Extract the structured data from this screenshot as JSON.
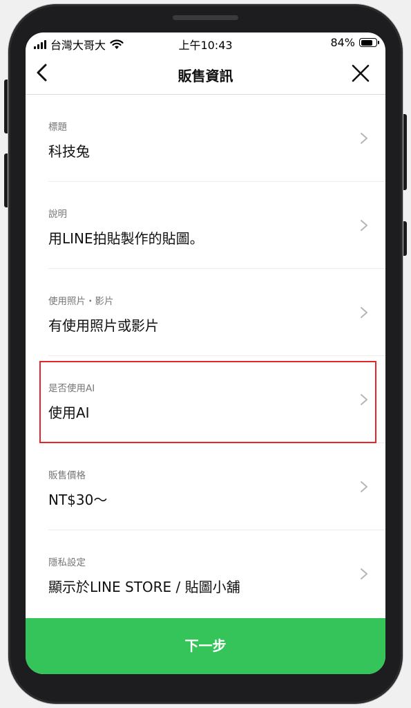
{
  "status_bar": {
    "carrier": "台灣大哥大",
    "time": "上午10:43",
    "battery": "84%",
    "battery_level": 0.84
  },
  "nav": {
    "title": "販售資訊",
    "back_icon": "chevron-left-icon",
    "close_icon": "close-icon"
  },
  "items": [
    {
      "label": "標題",
      "value": "科技兔"
    },
    {
      "label": "說明",
      "value": "用LINE拍貼製作的貼圖。"
    },
    {
      "label": "使用照片・影片",
      "value": "有使用照片或影片"
    },
    {
      "label": "是否使用AI",
      "value": "使用AI",
      "highlighted": true
    },
    {
      "label": "販售價格",
      "value": "NT$30～"
    },
    {
      "label": "隱私設定",
      "value": "顯示於LINE STORE / 貼圖小舖"
    }
  ],
  "next_button": {
    "label": "下一步"
  },
  "colors": {
    "accent_green": "#35c459",
    "highlight_red": "#e5252b"
  }
}
